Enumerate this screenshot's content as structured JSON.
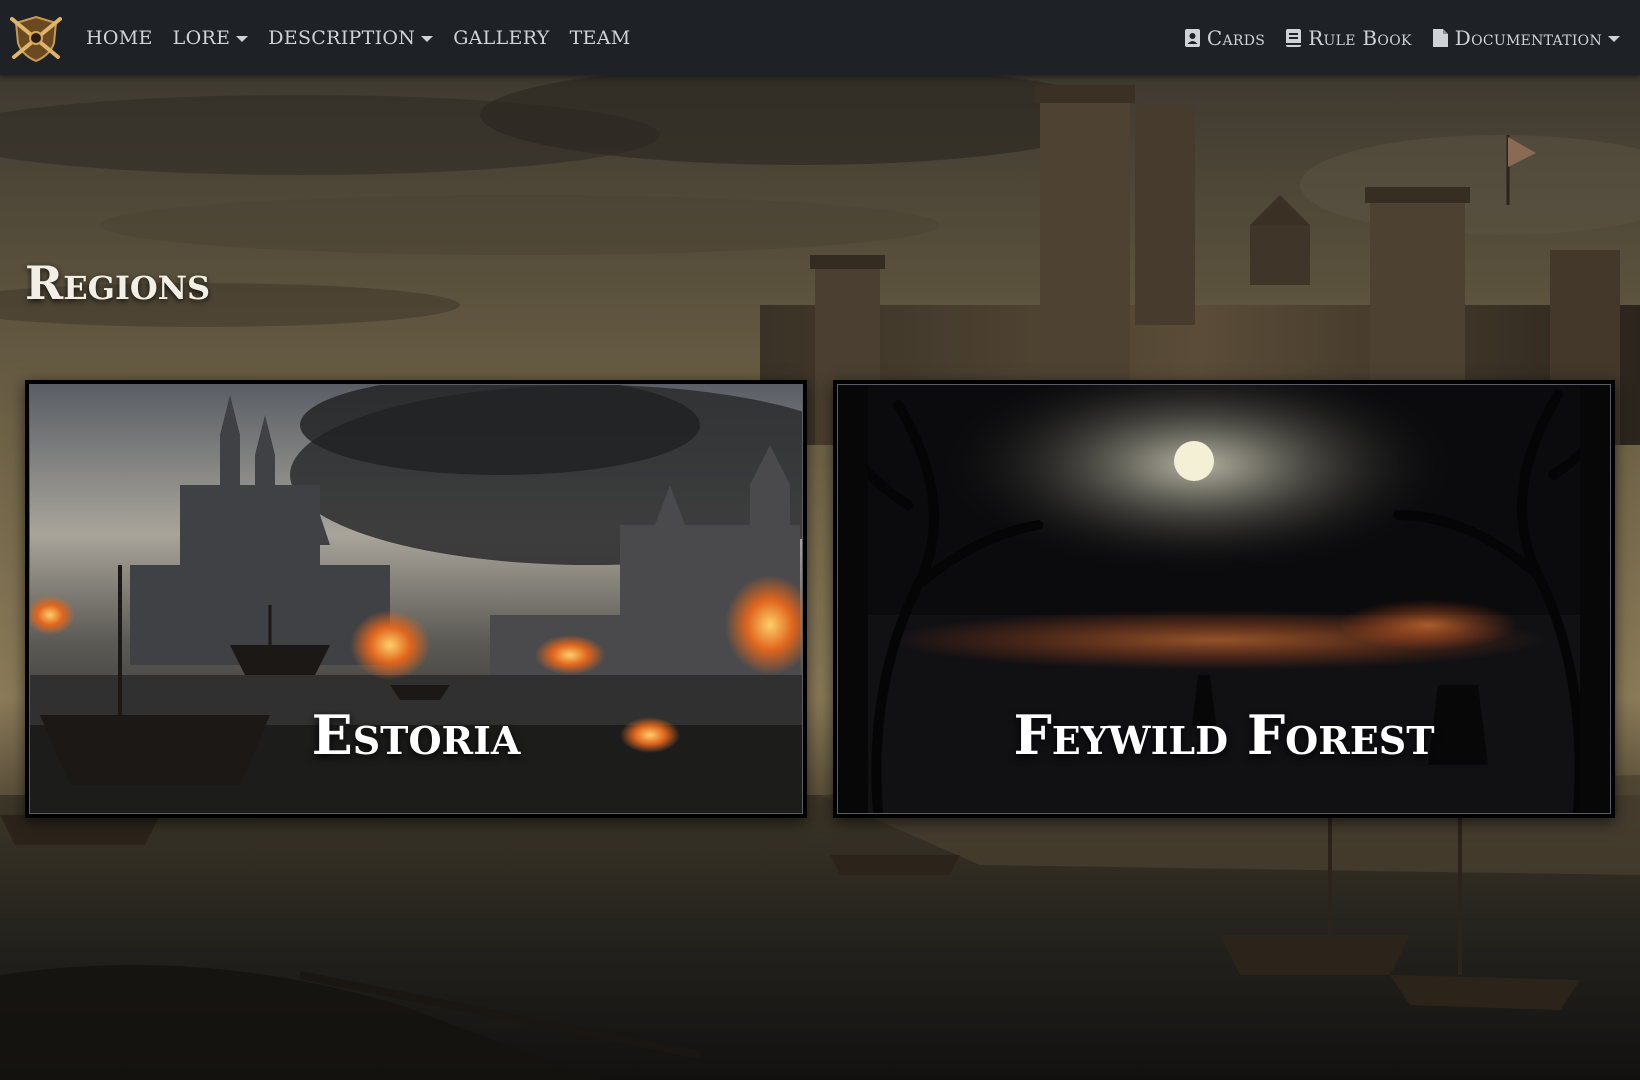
{
  "nav": {
    "left": [
      {
        "label": "HOME",
        "dropdown": false
      },
      {
        "label": "LORE",
        "dropdown": true
      },
      {
        "label": "DESCRIPTION",
        "dropdown": true
      },
      {
        "label": "GALLERY",
        "dropdown": false
      },
      {
        "label": "TEAM",
        "dropdown": false
      }
    ],
    "right": [
      {
        "label": "Cards",
        "icon": "id-card-icon",
        "dropdown": false
      },
      {
        "label": "Rule Book",
        "icon": "book-icon",
        "dropdown": false
      },
      {
        "label": "Documentation",
        "icon": "file-icon",
        "dropdown": true
      }
    ],
    "brand_icon": "crossed-swords-shield-icon"
  },
  "page": {
    "title": "Regions"
  },
  "regions": [
    {
      "name": "Estoria"
    },
    {
      "name": "Feywild Forest"
    }
  ],
  "colors": {
    "navbar": "#1e2126",
    "nav_text": "#cfd3d8",
    "title_text": "#f2efe6",
    "card_border": "#000000"
  }
}
